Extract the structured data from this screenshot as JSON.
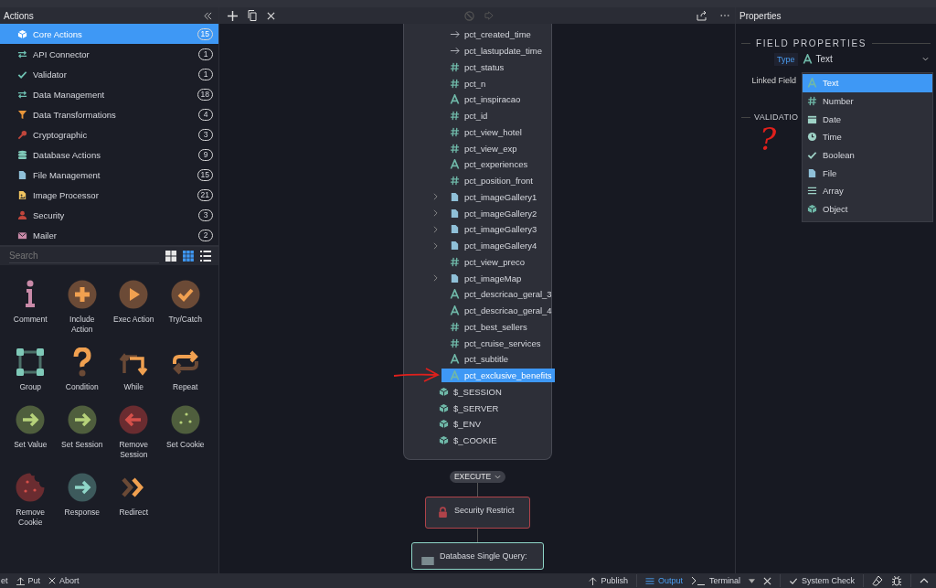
{
  "actions_panel": {
    "title": "Actions",
    "categories": [
      {
        "label": "Core Actions",
        "count": "15",
        "kind": "cube",
        "selected": true
      },
      {
        "label": "API Connector",
        "count": "1",
        "kind": "swap",
        "selected": false
      },
      {
        "label": "Validator",
        "count": "1",
        "kind": "check",
        "selected": false
      },
      {
        "label": "Data Management",
        "count": "18",
        "kind": "swap",
        "selected": false
      },
      {
        "label": "Data Transformations",
        "count": "4",
        "kind": "funnel",
        "selected": false
      },
      {
        "label": "Cryptographic",
        "count": "3",
        "kind": "key",
        "selected": false
      },
      {
        "label": "Database Actions",
        "count": "9",
        "kind": "database",
        "selected": false
      },
      {
        "label": "File Management",
        "count": "15",
        "kind": "file",
        "selected": false
      },
      {
        "label": "Image Processor",
        "count": "21",
        "kind": "image",
        "selected": false
      },
      {
        "label": "Security",
        "count": "3",
        "kind": "person",
        "selected": false
      },
      {
        "label": "Mailer",
        "count": "2",
        "kind": "envelope",
        "selected": false
      }
    ],
    "search": {
      "placeholder": "Search"
    },
    "view_modes": [
      {
        "kind": "large-grid",
        "selected": false
      },
      {
        "kind": "small-grid",
        "selected": true
      },
      {
        "kind": "list",
        "selected": false
      }
    ],
    "palette": [
      {
        "label": "Comment",
        "kind": "comment"
      },
      {
        "label": "Include Action",
        "kind": "include"
      },
      {
        "label": "Exec Action",
        "kind": "exec"
      },
      {
        "label": "Try/Catch",
        "kind": "try"
      },
      {
        "label": "Group",
        "kind": "group"
      },
      {
        "label": "Condition",
        "kind": "condition"
      },
      {
        "label": "While",
        "kind": "while"
      },
      {
        "label": "Repeat",
        "kind": "repeat"
      },
      {
        "label": "Set Value",
        "kind": "set-value"
      },
      {
        "label": "Set Session",
        "kind": "set-session"
      },
      {
        "label": "Remove Session",
        "kind": "remove-session"
      },
      {
        "label": "Set Cookie",
        "kind": "set-cookie"
      },
      {
        "label": "Remove Cookie",
        "kind": "remove-cookie"
      },
      {
        "label": "Response",
        "kind": "response"
      },
      {
        "label": "Redirect",
        "kind": "redirect"
      }
    ]
  },
  "field_card": {
    "fields": [
      {
        "name": "pct_created_time",
        "kind": "datetime",
        "expandable": false,
        "selected": false
      },
      {
        "name": "pct_lastupdate_time",
        "kind": "datetime",
        "expandable": false,
        "selected": false
      },
      {
        "name": "pct_status",
        "kind": "number",
        "expandable": false,
        "selected": false
      },
      {
        "name": "pct_n",
        "kind": "number",
        "expandable": false,
        "selected": false
      },
      {
        "name": "pct_inspiracao",
        "kind": "text",
        "expandable": false,
        "selected": false
      },
      {
        "name": "pct_id",
        "kind": "number",
        "expandable": false,
        "selected": false
      },
      {
        "name": "pct_view_hotel",
        "kind": "number",
        "expandable": false,
        "selected": false
      },
      {
        "name": "pct_view_exp",
        "kind": "number",
        "expandable": false,
        "selected": false
      },
      {
        "name": "pct_experiences",
        "kind": "text",
        "expandable": false,
        "selected": false
      },
      {
        "name": "pct_position_front",
        "kind": "number",
        "expandable": false,
        "selected": false
      },
      {
        "name": "pct_imageGallery1",
        "kind": "file",
        "expandable": true,
        "selected": false
      },
      {
        "name": "pct_imageGallery2",
        "kind": "file",
        "expandable": true,
        "selected": false
      },
      {
        "name": "pct_imageGallery3",
        "kind": "file",
        "expandable": true,
        "selected": false
      },
      {
        "name": "pct_imageGallery4",
        "kind": "file",
        "expandable": true,
        "selected": false
      },
      {
        "name": "pct_view_preco",
        "kind": "number",
        "expandable": false,
        "selected": false
      },
      {
        "name": "pct_imageMap",
        "kind": "file",
        "expandable": true,
        "selected": false
      },
      {
        "name": "pct_descricao_geral_3",
        "kind": "text",
        "expandable": false,
        "selected": false
      },
      {
        "name": "pct_descricao_geral_4",
        "kind": "text",
        "expandable": false,
        "selected": false
      },
      {
        "name": "pct_best_sellers",
        "kind": "number",
        "expandable": false,
        "selected": false
      },
      {
        "name": "pct_cruise_services",
        "kind": "number",
        "expandable": false,
        "selected": false
      },
      {
        "name": "pct_subtitle",
        "kind": "text",
        "expandable": false,
        "selected": false
      },
      {
        "name": "pct_exclusive_benefits",
        "kind": "text",
        "expandable": false,
        "selected": true
      }
    ],
    "globals": [
      {
        "name": "$_SESSION",
        "kind": "object"
      },
      {
        "name": "$_SERVER",
        "kind": "object"
      },
      {
        "name": "$_ENV",
        "kind": "object"
      },
      {
        "name": "$_COOKIE",
        "kind": "object"
      }
    ]
  },
  "execute_label": "EXECUTE",
  "nodes": [
    {
      "title": "Security Restrict",
      "kind": "security"
    },
    {
      "title": "Database Single Query:",
      "kind": "database"
    }
  ],
  "annotation": {
    "text": "?"
  },
  "properties_panel": {
    "title": "Properties",
    "section": "FIELD PROPERTIES",
    "type_label": "Type",
    "type_value": {
      "kind": "text",
      "label": "Text"
    },
    "linked_field_label": "Linked Field",
    "validation_heading": "VALIDATIO",
    "type_options": [
      {
        "label": "Text",
        "kind": "text",
        "selected": true
      },
      {
        "label": "Number",
        "kind": "number",
        "selected": false
      },
      {
        "label": "Date",
        "kind": "date",
        "selected": false
      },
      {
        "label": "Time",
        "kind": "time",
        "selected": false
      },
      {
        "label": "Boolean",
        "kind": "boolean",
        "selected": false
      },
      {
        "label": "File",
        "kind": "file",
        "selected": false
      },
      {
        "label": "Array",
        "kind": "array",
        "selected": false
      },
      {
        "label": "Object",
        "kind": "object",
        "selected": false
      }
    ]
  },
  "status_bar": {
    "left_buttons": [
      {
        "label": "et",
        "kind": "plain"
      },
      {
        "label": "Put",
        "kind": "upload"
      },
      {
        "label": "Abort",
        "kind": "close"
      }
    ],
    "publish": "Publish",
    "tabs": [
      {
        "label": "Output",
        "kind": "output",
        "selected": true
      },
      {
        "label": "Terminal",
        "kind": "terminal",
        "selected": false
      }
    ],
    "system_check": "System Check"
  }
}
